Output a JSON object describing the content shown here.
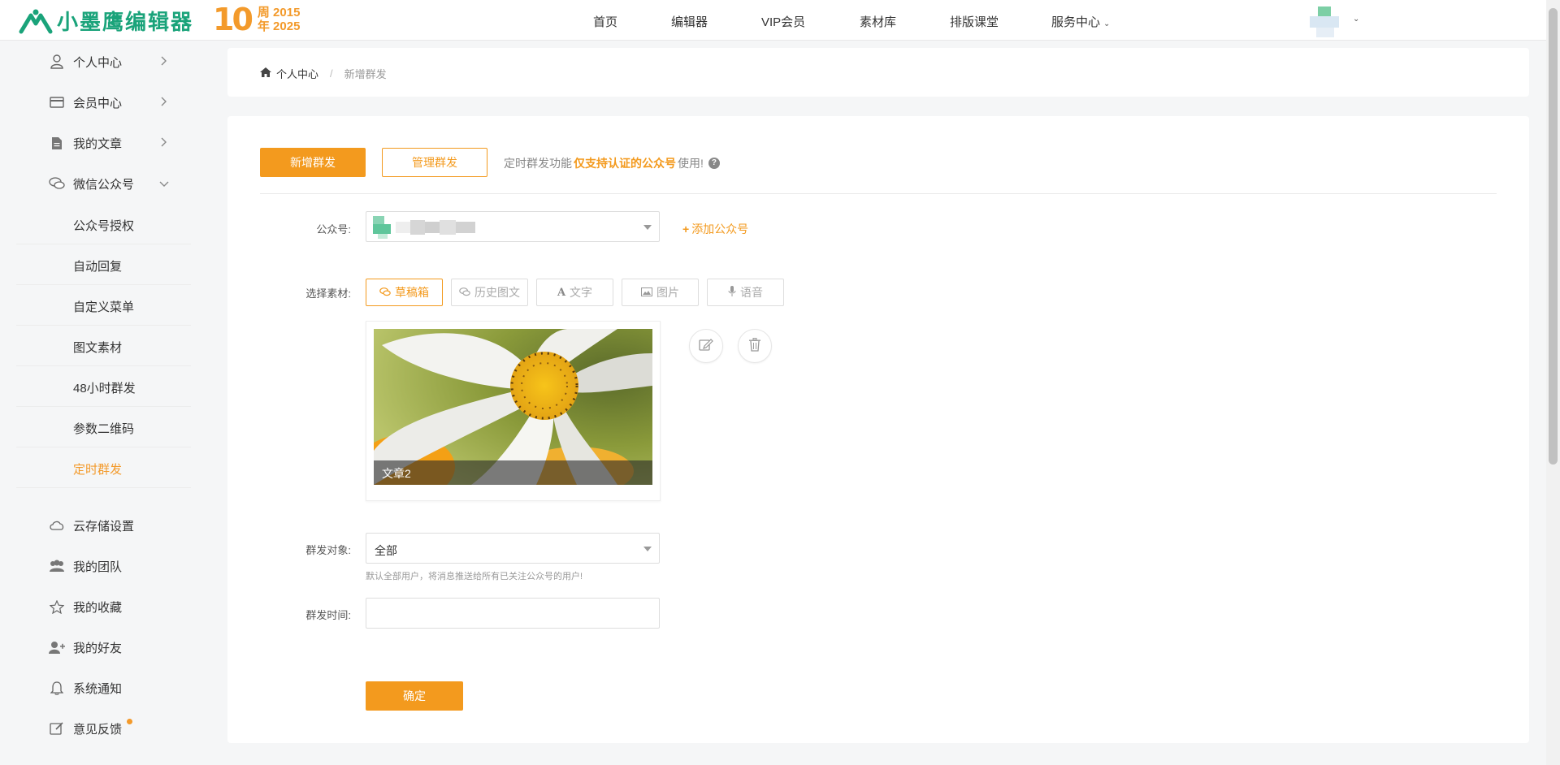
{
  "header": {
    "logo_text": "小墨鹰编辑器",
    "anniversary_number": "10",
    "anniversary_line1": "周 2015",
    "anniversary_line2": "年 2025",
    "nav": [
      "首页",
      "编辑器",
      "VIP会员",
      "素材库",
      "排版课堂",
      "服务中心"
    ]
  },
  "sidebar": {
    "items": [
      {
        "label": "个人中心",
        "icon": "user-icon",
        "arrow": "right"
      },
      {
        "label": "会员中心",
        "icon": "card-icon",
        "arrow": "right"
      },
      {
        "label": "我的文章",
        "icon": "document-icon",
        "arrow": "right"
      },
      {
        "label": "微信公众号",
        "icon": "chat-icon",
        "arrow": "down"
      }
    ],
    "sub_items": [
      "公众号授权",
      "自动回复",
      "自定义菜单",
      "图文素材",
      "48小时群发",
      "参数二维码",
      "定时群发"
    ],
    "active_sub": "定时群发",
    "bottom_items": [
      {
        "label": "云存储设置",
        "icon": "cloud-icon"
      },
      {
        "label": "我的团队",
        "icon": "team-icon"
      },
      {
        "label": "我的收藏",
        "icon": "star-icon"
      },
      {
        "label": "我的好友",
        "icon": "add-friend-icon"
      },
      {
        "label": "系统通知",
        "icon": "bell-icon"
      },
      {
        "label": "意见反馈",
        "icon": "feedback-icon"
      }
    ]
  },
  "breadcrumb": {
    "home": "个人中心",
    "current": "新增群发"
  },
  "main": {
    "new_button": "新增群发",
    "manage_button": "管理群发",
    "tip_prefix": "定时群发功能",
    "tip_emphasis": "仅支持认证的公众号",
    "tip_suffix": "使用!",
    "account_label": "公众号:",
    "add_account": "添加公众号",
    "material_label": "选择素材:",
    "material_tabs": [
      "草稿箱",
      "历史图文",
      "文字",
      "图片",
      "语音"
    ],
    "active_tab": "草稿箱",
    "article_caption": "文章2",
    "target_label": "群发对象:",
    "target_value": "全部",
    "target_hint": "默认全部用户，将消息推送给所有已关注公众号的用户!",
    "time_label": "群发时间:",
    "time_value": "",
    "confirm_button": "确定"
  },
  "colors": {
    "accent": "#f39a1e",
    "brand_green": "#1aa37a"
  }
}
